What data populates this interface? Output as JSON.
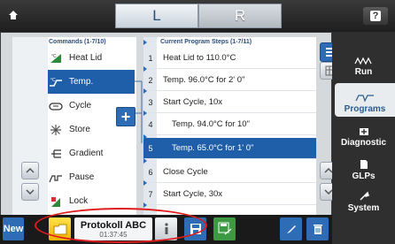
{
  "tabs": [
    "L",
    "R"
  ],
  "help_label": "?",
  "nav": [
    {
      "label": "Run",
      "icon": "run-icon",
      "active": false
    },
    {
      "label": "Programs",
      "icon": "programs-icon",
      "active": true
    },
    {
      "label": "Diagnostic",
      "icon": "diagnostic-icon",
      "active": false
    },
    {
      "label": "GLPs",
      "icon": "glps-icon",
      "active": false
    },
    {
      "label": "System",
      "icon": "system-icon",
      "active": false
    }
  ],
  "commands": {
    "header": "Commands (1-7/10)",
    "items": [
      {
        "label": "Heat Lid",
        "icon": "heat-lid-icon"
      },
      {
        "label": "Temp.",
        "icon": "temp-icon",
        "selected": true
      },
      {
        "label": "Cycle",
        "icon": "cycle-icon"
      },
      {
        "label": "Store",
        "icon": "store-icon"
      },
      {
        "label": "Gradient",
        "icon": "gradient-icon"
      },
      {
        "label": "Pause",
        "icon": "pause-icon"
      },
      {
        "label": "Lock",
        "icon": "lock-icon"
      }
    ]
  },
  "steps": {
    "header": "Current Program Steps (1-7/11)",
    "items": [
      {
        "n": "1",
        "label": "Heat Lid to 110.0°C"
      },
      {
        "n": "2",
        "label": "Temp.  96.0°C for 2' 0\""
      },
      {
        "n": "3",
        "label": "Start Cycle, 10x"
      },
      {
        "n": "4",
        "label": "Temp.  94.0°C for 10\"",
        "indent": true
      },
      {
        "n": "5",
        "label": "Temp.  65.0°C for 1' 0\"",
        "indent": true,
        "selected": true
      },
      {
        "n": "6",
        "label": "Close Cycle"
      },
      {
        "n": "7",
        "label": "Start Cycle, 30x"
      }
    ]
  },
  "bottom": {
    "new_label": "New",
    "program_name": "Protokoll ABC",
    "program_time": "01:37:45"
  },
  "colors": {
    "accent": "#1f5ea8",
    "highlight": "#e01b1b",
    "folder": "#f1b100",
    "save_as": "#3d9a42"
  }
}
